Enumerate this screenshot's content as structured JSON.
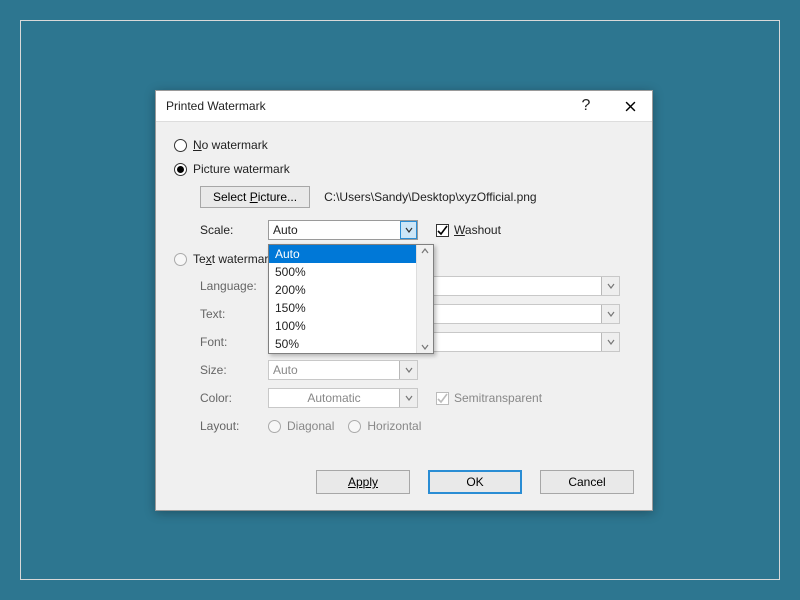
{
  "dialog": {
    "title": "Printed Watermark",
    "no_watermark_label_pre": "N",
    "no_watermark_label_post": "o watermark",
    "picture_watermark_label": "P",
    "picture_watermark_post": "icture watermark",
    "select_picture_label_pre": "Select ",
    "select_picture_label_ul": "P",
    "select_picture_label_post": "icture...",
    "picture_path": "C:\\Users\\Sandy\\Desktop\\xyzOfficial.png",
    "scale_label": "Scale:",
    "scale_value": "Auto",
    "washout_label_ul": "W",
    "washout_label_post": "ashout",
    "text_watermark_label_pre": "Te",
    "text_watermark_label_ul": "x",
    "text_watermark_label_post": "t watermark",
    "language_label": "Language:",
    "text_label": "Text:",
    "font_label": "Font:",
    "size_label": "Size:",
    "size_value": "Auto",
    "color_label": "Color:",
    "color_value": "Automatic",
    "semitransparent_label": "Semitransparent",
    "layout_label": "Layout:",
    "layout_diagonal": "Diagonal",
    "layout_horizontal": "Horizontal",
    "apply_label": "Apply",
    "ok_label": "OK",
    "cancel_label": "Cancel"
  },
  "scale_options": {
    "o0": "Auto",
    "o1": "500%",
    "o2": "200%",
    "o3": "150%",
    "o4": "100%",
    "o5": "50%"
  }
}
